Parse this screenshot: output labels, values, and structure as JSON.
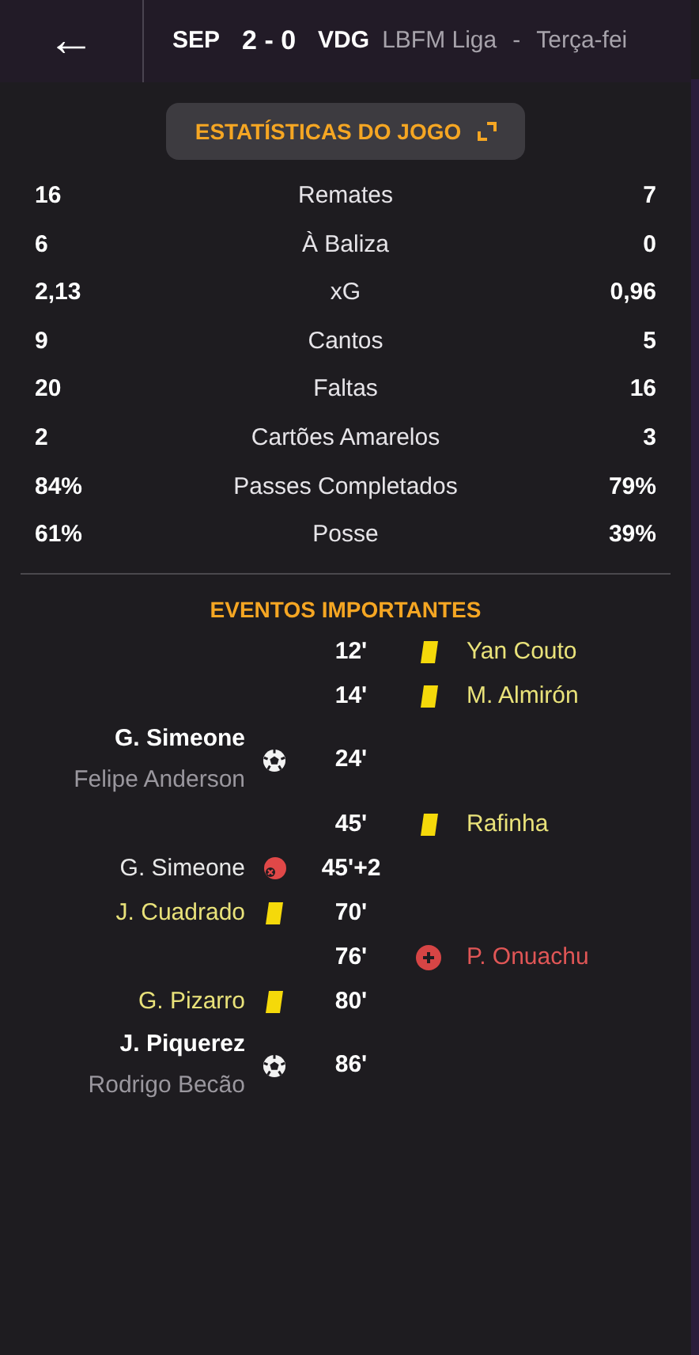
{
  "header": {
    "back_label": "←",
    "home_team": "SEP",
    "score": "2 - 0",
    "away_team": "VDG",
    "competition": "LBFM Liga",
    "separator": "-",
    "date": "Terça-fei"
  },
  "stats_button": {
    "label": "ESTATÍSTICAS DO JOGO"
  },
  "stats": [
    {
      "home": "16",
      "label": "Remates",
      "away": "7"
    },
    {
      "home": "6",
      "label": "À Baliza",
      "away": "0"
    },
    {
      "home": "2,13",
      "label": "xG",
      "away": "0,96"
    },
    {
      "home": "9",
      "label": "Cantos",
      "away": "5"
    },
    {
      "home": "20",
      "label": "Faltas",
      "away": "16"
    },
    {
      "home": "2",
      "label": "Cartões Amarelos",
      "away": "3"
    },
    {
      "home": "84%",
      "label": "Passes Completados",
      "away": "79%"
    },
    {
      "home": "61%",
      "label": "Posse",
      "away": "39%"
    }
  ],
  "events_title": "EVENTOS IMPORTANTES",
  "events": [
    {
      "away_team": true,
      "kind": "yellow",
      "minute": "12'",
      "player": "Yan Couto"
    },
    {
      "away_team": true,
      "kind": "yellow",
      "minute": "14'",
      "player": "M. Almirón"
    },
    {
      "away_team": false,
      "kind": "goal",
      "minute": "24'",
      "player": "G. Simeone",
      "assist": "Felipe Anderson"
    },
    {
      "away_team": true,
      "kind": "yellow",
      "minute": "45'",
      "player": "Rafinha"
    },
    {
      "away_team": false,
      "kind": "own_goal",
      "minute": "45'+2",
      "player": "G. Simeone"
    },
    {
      "away_team": false,
      "kind": "yellow",
      "minute": "70'",
      "player": "J. Cuadrado"
    },
    {
      "away_team": true,
      "kind": "injury",
      "minute": "76'",
      "player": "P. Onuachu"
    },
    {
      "away_team": false,
      "kind": "yellow",
      "minute": "80'",
      "player": "G. Pizarro"
    },
    {
      "away_team": false,
      "kind": "goal",
      "minute": "86'",
      "player": "J. Piquerez",
      "assist": "Rodrigo Becão"
    }
  ]
}
